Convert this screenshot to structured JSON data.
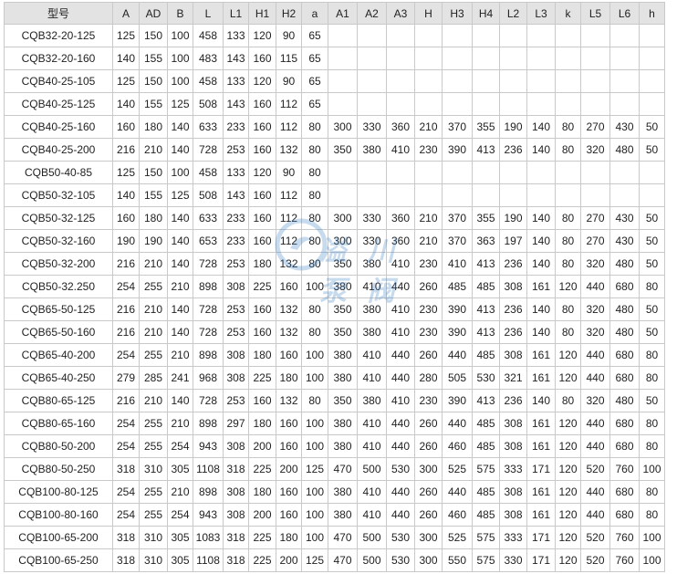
{
  "table": {
    "headers": [
      "型号",
      "A",
      "AD",
      "B",
      "L",
      "L1",
      "H1",
      "H2",
      "a",
      "A1",
      "A2",
      "A3",
      "H",
      "H3",
      "H4",
      "L2",
      "L3",
      "k",
      "L5",
      "L6",
      "h"
    ],
    "rows": [
      [
        "CQB32-20-125",
        "125",
        "150",
        "100",
        "458",
        "133",
        "120",
        "90",
        "65",
        "",
        "",
        "",
        "",
        "",
        "",
        "",
        "",
        "",
        "",
        "",
        ""
      ],
      [
        "CQB32-20-160",
        "140",
        "155",
        "100",
        "483",
        "143",
        "160",
        "115",
        "65",
        "",
        "",
        "",
        "",
        "",
        "",
        "",
        "",
        "",
        "",
        "",
        ""
      ],
      [
        "CQB40-25-105",
        "125",
        "150",
        "100",
        "458",
        "133",
        "120",
        "90",
        "65",
        "",
        "",
        "",
        "",
        "",
        "",
        "",
        "",
        "",
        "",
        "",
        ""
      ],
      [
        "CQB40-25-125",
        "140",
        "155",
        "125",
        "508",
        "143",
        "160",
        "112",
        "65",
        "",
        "",
        "",
        "",
        "",
        "",
        "",
        "",
        "",
        "",
        "",
        ""
      ],
      [
        "CQB40-25-160",
        "160",
        "180",
        "140",
        "633",
        "233",
        "160",
        "112",
        "80",
        "300",
        "330",
        "360",
        "210",
        "370",
        "355",
        "190",
        "140",
        "80",
        "270",
        "430",
        "50"
      ],
      [
        "CQB40-25-200",
        "216",
        "210",
        "140",
        "728",
        "253",
        "160",
        "132",
        "80",
        "350",
        "380",
        "410",
        "230",
        "390",
        "413",
        "236",
        "140",
        "80",
        "320",
        "480",
        "50"
      ],
      [
        "CQB50-40-85",
        "125",
        "150",
        "100",
        "458",
        "133",
        "120",
        "90",
        "80",
        "",
        "",
        "",
        "",
        "",
        "",
        "",
        "",
        "",
        "",
        "",
        ""
      ],
      [
        "CQB50-32-105",
        "140",
        "155",
        "125",
        "508",
        "143",
        "160",
        "112",
        "80",
        "",
        "",
        "",
        "",
        "",
        "",
        "",
        "",
        "",
        "",
        "",
        ""
      ],
      [
        "CQB50-32-125",
        "160",
        "180",
        "140",
        "633",
        "233",
        "160",
        "112",
        "80",
        "300",
        "330",
        "360",
        "210",
        "370",
        "355",
        "190",
        "140",
        "80",
        "270",
        "430",
        "50"
      ],
      [
        "CQB50-32-160",
        "190",
        "190",
        "140",
        "653",
        "233",
        "160",
        "112",
        "80",
        "300",
        "330",
        "360",
        "210",
        "370",
        "363",
        "197",
        "140",
        "80",
        "270",
        "430",
        "50"
      ],
      [
        "CQB50-32-200",
        "216",
        "210",
        "140",
        "728",
        "253",
        "180",
        "132",
        "80",
        "350",
        "380",
        "410",
        "230",
        "410",
        "413",
        "236",
        "140",
        "80",
        "320",
        "480",
        "50"
      ],
      [
        "CQB50-32.250",
        "254",
        "255",
        "210",
        "898",
        "308",
        "225",
        "160",
        "100",
        "380",
        "410",
        "440",
        "260",
        "485",
        "485",
        "308",
        "161",
        "120",
        "440",
        "680",
        "80"
      ],
      [
        "CQB65-50-125",
        "216",
        "210",
        "140",
        "728",
        "253",
        "160",
        "132",
        "80",
        "350",
        "380",
        "410",
        "230",
        "390",
        "413",
        "236",
        "140",
        "80",
        "320",
        "480",
        "50"
      ],
      [
        "CQB65-50-160",
        "216",
        "210",
        "140",
        "728",
        "253",
        "160",
        "132",
        "80",
        "350",
        "380",
        "410",
        "230",
        "390",
        "413",
        "236",
        "140",
        "80",
        "320",
        "480",
        "50"
      ],
      [
        "CQB65-40-200",
        "254",
        "255",
        "210",
        "898",
        "308",
        "180",
        "160",
        "100",
        "380",
        "410",
        "440",
        "260",
        "440",
        "485",
        "308",
        "161",
        "120",
        "440",
        "680",
        "80"
      ],
      [
        "CQB65-40-250",
        "279",
        "285",
        "241",
        "968",
        "308",
        "225",
        "180",
        "100",
        "380",
        "410",
        "440",
        "280",
        "505",
        "530",
        "321",
        "161",
        "120",
        "440",
        "680",
        "80"
      ],
      [
        "CQB80-65-125",
        "216",
        "210",
        "140",
        "728",
        "253",
        "160",
        "132",
        "80",
        "350",
        "380",
        "410",
        "230",
        "390",
        "413",
        "236",
        "140",
        "80",
        "320",
        "480",
        "50"
      ],
      [
        "CQB80-65-160",
        "254",
        "255",
        "210",
        "898",
        "297",
        "180",
        "160",
        "100",
        "380",
        "410",
        "440",
        "260",
        "440",
        "485",
        "308",
        "161",
        "120",
        "440",
        "680",
        "80"
      ],
      [
        "CQB80-50-200",
        "254",
        "255",
        "254",
        "943",
        "308",
        "200",
        "160",
        "100",
        "380",
        "410",
        "440",
        "260",
        "460",
        "485",
        "308",
        "161",
        "120",
        "440",
        "680",
        "80"
      ],
      [
        "CQB80-50-250",
        "318",
        "310",
        "305",
        "1108",
        "318",
        "225",
        "200",
        "125",
        "470",
        "500",
        "530",
        "300",
        "525",
        "575",
        "333",
        "171",
        "120",
        "520",
        "760",
        "100"
      ],
      [
        "CQB100-80-125",
        "254",
        "255",
        "210",
        "898",
        "308",
        "180",
        "160",
        "100",
        "380",
        "410",
        "440",
        "260",
        "440",
        "485",
        "308",
        "161",
        "120",
        "440",
        "680",
        "80"
      ],
      [
        "CQB100-80-160",
        "254",
        "255",
        "254",
        "943",
        "308",
        "200",
        "160",
        "100",
        "380",
        "410",
        "440",
        "260",
        "460",
        "485",
        "308",
        "161",
        "120",
        "440",
        "680",
        "80"
      ],
      [
        "CQB100-65-200",
        "318",
        "310",
        "305",
        "1083",
        "318",
        "225",
        "180",
        "100",
        "470",
        "500",
        "530",
        "300",
        "525",
        "575",
        "333",
        "171",
        "120",
        "520",
        "760",
        "100"
      ],
      [
        "CQB100-65-250",
        "318",
        "310",
        "305",
        "1108",
        "318",
        "225",
        "200",
        "125",
        "470",
        "500",
        "530",
        "300",
        "550",
        "575",
        "330",
        "171",
        "120",
        "520",
        "760",
        "100"
      ]
    ]
  },
  "watermark": {
    "text": "溢 川 泵 阀",
    "color": "#3b7fc4"
  }
}
